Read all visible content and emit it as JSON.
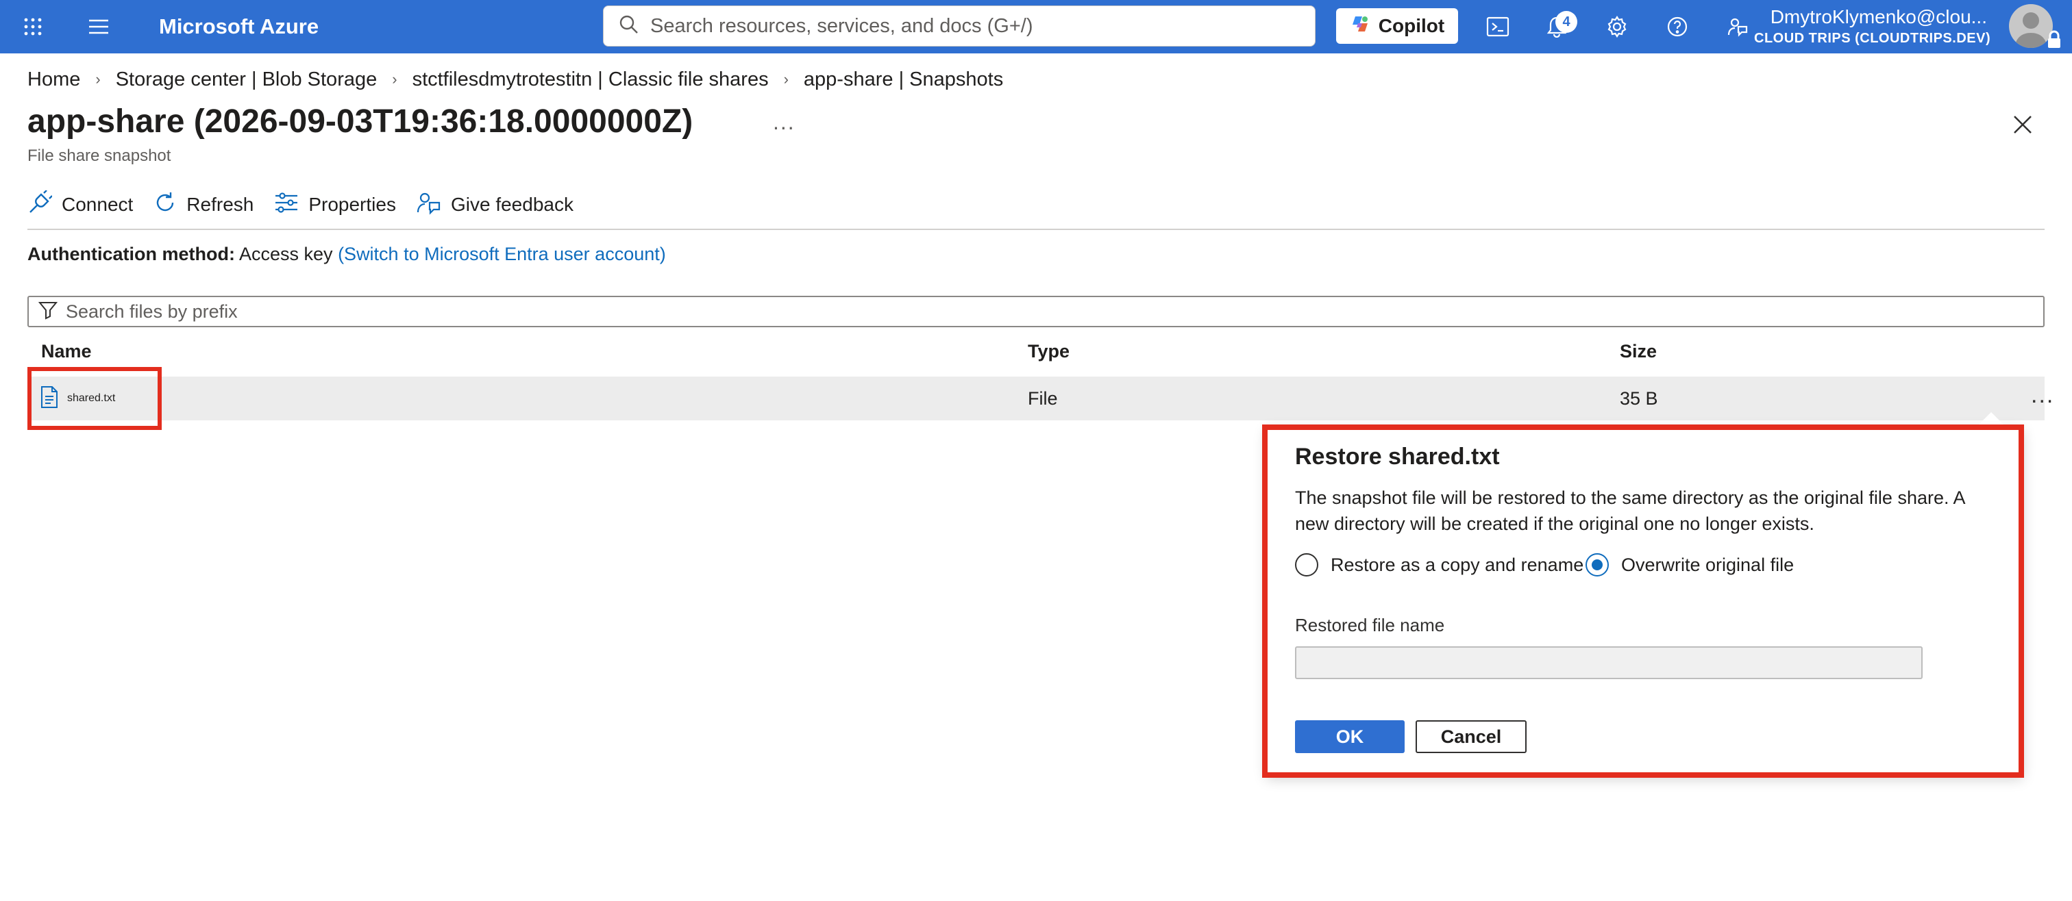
{
  "topbar": {
    "brand": "Microsoft Azure",
    "search_placeholder": "Search resources, services, and docs (G+/)",
    "copilot_label": "Copilot",
    "notification_count": "4",
    "user": "DmytroKlymenko@clou...",
    "tenant": "CLOUD TRIPS (CLOUDTRIPS.DEV)",
    "icons": [
      "app-launcher-icon",
      "hamburger-menu-icon",
      "search-icon",
      "cloud-shell-icon",
      "bell-icon",
      "gear-icon",
      "help-icon",
      "feedback-icon",
      "avatar",
      "lock-icon"
    ]
  },
  "breadcrumb": [
    "Home",
    "Storage center | Blob Storage",
    "stctfilesdmytrotestitn | Classic file shares",
    "app-share | Snapshots"
  ],
  "page": {
    "title": "app-share (2026-09-03T19:36:18.0000000Z)",
    "more": "...",
    "subtitle": "File share snapshot"
  },
  "toolbar": {
    "connect": "Connect",
    "refresh": "Refresh",
    "properties": "Properties",
    "feedback": "Give feedback"
  },
  "auth": {
    "label": "Authentication method:",
    "value": "Access key",
    "link": "(Switch to Microsoft Entra user account)"
  },
  "filter_placeholder": "Search files by prefix",
  "table": {
    "columns": [
      "Name",
      "Type",
      "Size"
    ],
    "rows": [
      {
        "name": "shared.txt",
        "type": "File",
        "size": "35 B"
      }
    ],
    "row_more": "..."
  },
  "restore_dialog": {
    "title": "Restore shared.txt",
    "description": "The snapshot file will be restored to the same directory as the original file share. A new directory will be created if the original one no longer exists.",
    "option_copy": "Restore as a copy and rename",
    "option_overwrite": "Overwrite original file",
    "selected_option": "Overwrite original file",
    "field_label": "Restored file name",
    "field_value": "",
    "ok_label": "OK",
    "cancel_label": "Cancel"
  },
  "colors": {
    "topbar": "#2f6fd1",
    "link": "#0f6cbd",
    "highlight": "#e32d1e",
    "row_selected": "#ececec"
  }
}
